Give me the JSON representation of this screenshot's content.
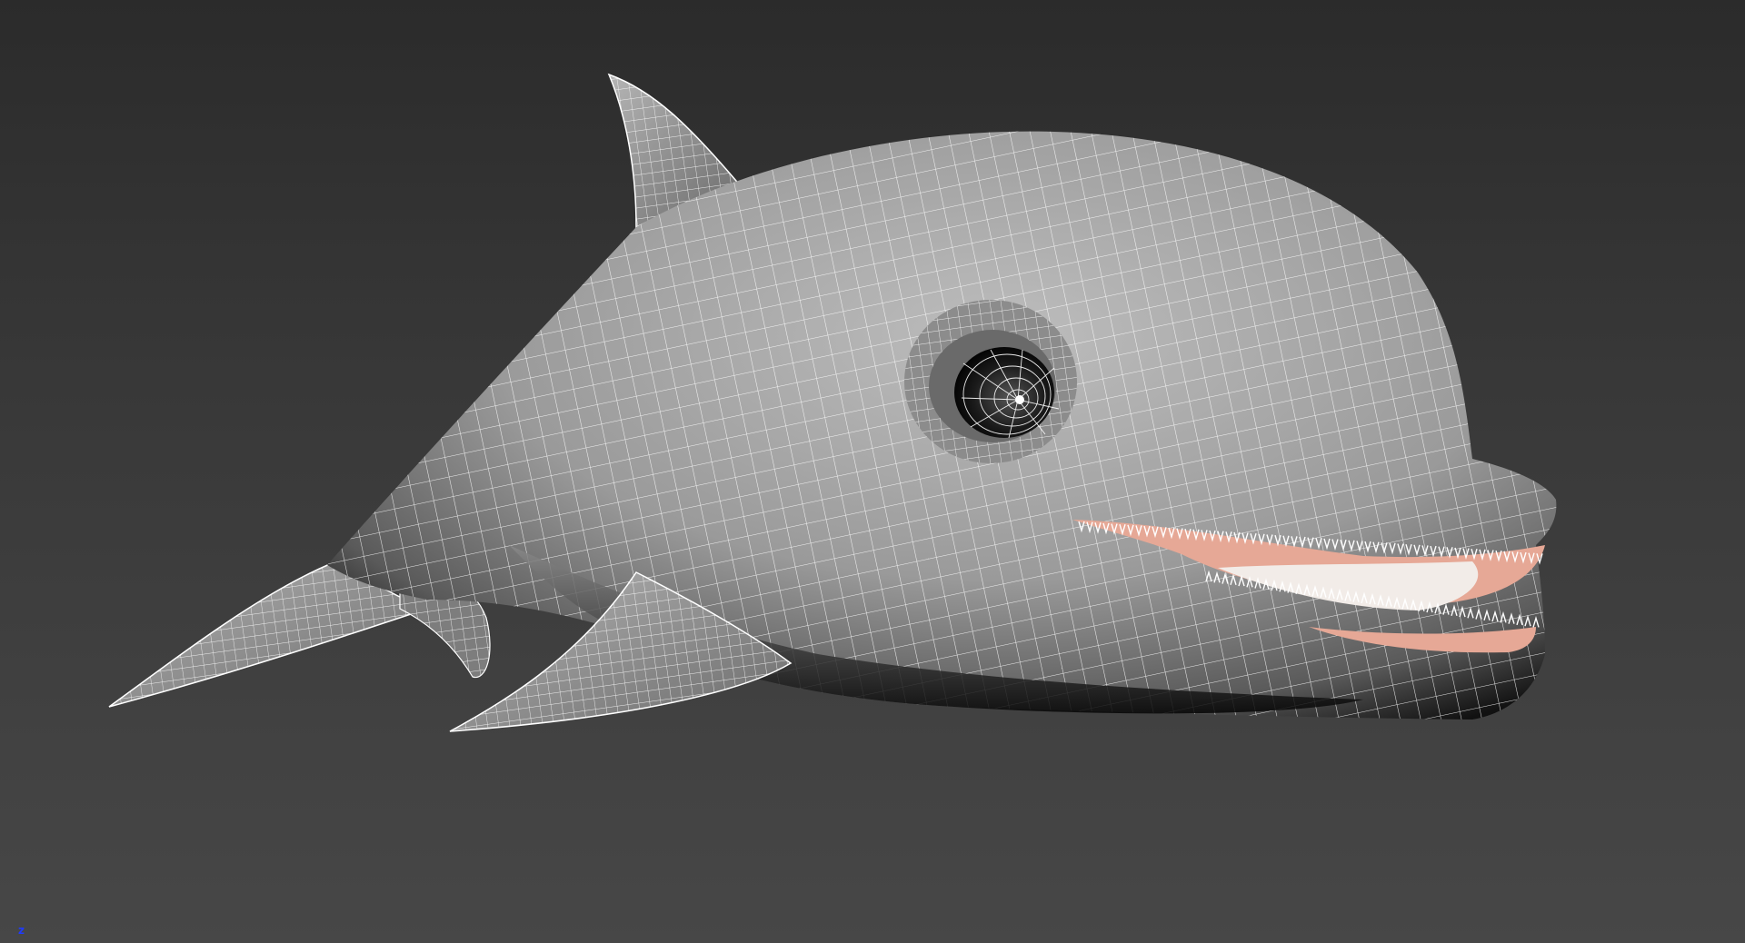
{
  "viewport": {
    "axis_indicator": "z",
    "model": "dolphin",
    "display_mode": "shaded-with-wireframe",
    "colors": {
      "background_top": "#2b2b2b",
      "background_bottom": "#474747",
      "mesh_shade": "#9a9a9a",
      "wire": "#ffffff",
      "gum": "#e6a896",
      "teeth": "#f2ece8"
    },
    "icons": [
      "dolphin-mesh-icon",
      "axis-gizmo-icon"
    ]
  }
}
